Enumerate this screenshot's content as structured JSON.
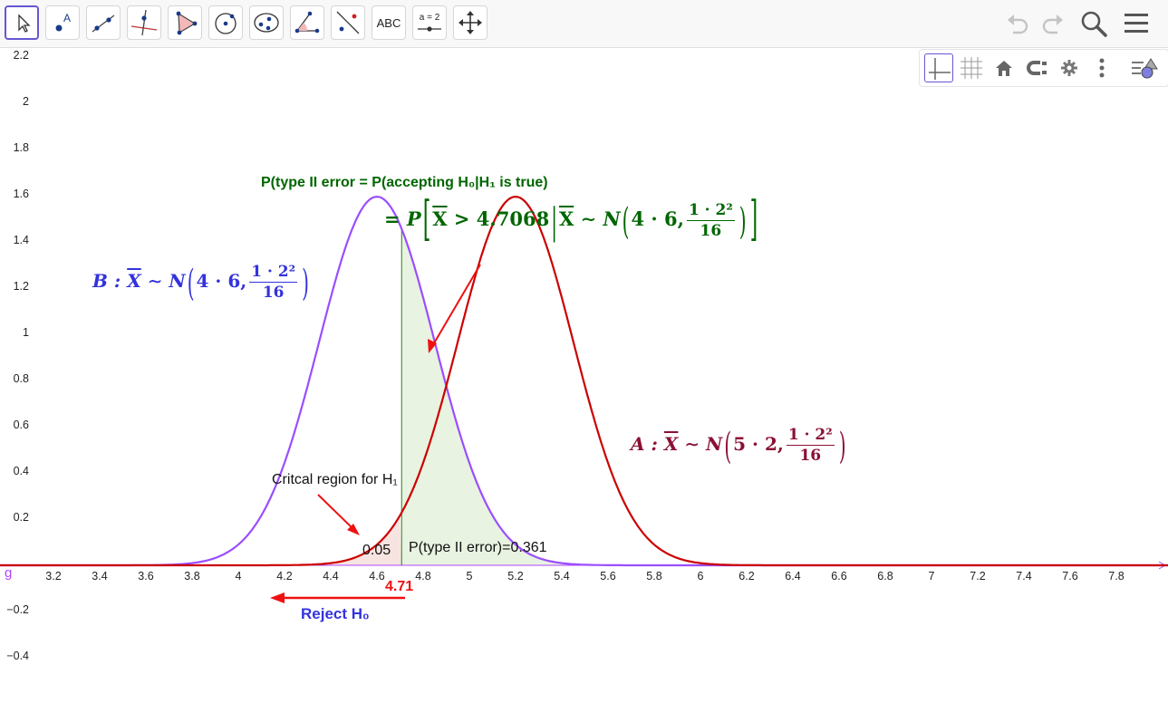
{
  "toolbar": {
    "tools": [
      {
        "name": "move-tool",
        "icon": "cursor-arrow-icon"
      },
      {
        "name": "point-tool",
        "icon": "point-icon",
        "label": "A"
      },
      {
        "name": "line-tool",
        "icon": "line-icon"
      },
      {
        "name": "perpendicular-line-tool",
        "icon": "perpendicular-icon"
      },
      {
        "name": "polygon-tool",
        "icon": "polygon-icon"
      },
      {
        "name": "circle-center-point-tool",
        "icon": "circle-icon"
      },
      {
        "name": "ellipse-tool",
        "icon": "ellipse-icon"
      },
      {
        "name": "angle-tool",
        "icon": "angle-icon",
        "label": "α"
      },
      {
        "name": "reflect-tool",
        "icon": "reflect-icon"
      },
      {
        "name": "text-tool",
        "icon": "text-icon",
        "label": "ABC"
      },
      {
        "name": "slider-tool",
        "icon": "slider-icon",
        "label": "a = 2"
      },
      {
        "name": "move-graphics-view-tool",
        "icon": "move-arrows-icon"
      }
    ],
    "right_icons": [
      "undo-icon",
      "redo-icon",
      "search-icon",
      "menu-icon"
    ]
  },
  "stylebar": {
    "icons": [
      "axes-icon",
      "grid-icon",
      "home-icon",
      "point-capturing-icon",
      "settings-icon",
      "more-vertical-icon",
      "style-bar-toggle-icon"
    ]
  },
  "axes": {
    "y_ticks": [
      "2.2",
      "2",
      "1.8",
      "1.6",
      "1.4",
      "1.2",
      "1",
      "0.8",
      "0.6",
      "0.4",
      "0.2",
      "−0.2",
      "−0.4"
    ],
    "x_ticks": [
      "3.2",
      "3.4",
      "3.6",
      "3.8",
      "4",
      "4.2",
      "4.4",
      "4.6",
      "4.8",
      "5",
      "5.2",
      "5.4",
      "5.6",
      "5.8",
      "6",
      "6.2",
      "6.4",
      "6.6",
      "6.8",
      "7",
      "7.2",
      "7.4",
      "7.6",
      "7.8"
    ],
    "origin_label": "g"
  },
  "annotations": {
    "type2_title": "P(type II error = P(accepting H₀|H₁ is true)",
    "type2_formula": {
      "prefix": "= P",
      "xbar": "X",
      "gt": " > 4.7068",
      "sim": " ∼ N",
      "mean": "4 · 6,",
      "num": "1 · 2²",
      "den": "16"
    },
    "dist_b": {
      "label": "B :",
      "xbar": "X",
      "sim": " ∼ N",
      "mean": "4 · 6,",
      "num": "1 · 2²",
      "den": "16"
    },
    "dist_a": {
      "label": "A :",
      "xbar": "X",
      "sim": " ∼ N",
      "mean": "5 · 2,",
      "num": "1 · 2²",
      "den": "16"
    },
    "critical_region": "Critcal region for H₁",
    "alpha_value": "0.05",
    "type2_value": "P(type II error)=0.361",
    "critical_value": "4.71",
    "reject_label": "Reject H₀"
  },
  "chart_data": {
    "type": "line",
    "xlim": [
      3.2,
      7.8
    ],
    "ylim": [
      -0.4,
      2.2
    ],
    "series": [
      {
        "mean": 4.6,
        "variance": 0.0625,
        "color": "#9b4dff"
      },
      {
        "mean": 5.2,
        "variance": 0.0625,
        "color": "#cc0000"
      }
    ],
    "critical_x": 4.7068,
    "shaded_type2_area": 0.361,
    "shaded_critical_area": 0.05
  },
  "colors": {
    "curve_b": "#9b4dff",
    "curve_a": "#cc0000",
    "green_text": "#006600",
    "blue_text": "#3333dd",
    "maroon_text": "#8b1034",
    "red": "#ee1111",
    "selected_tool": "#6557d2"
  }
}
